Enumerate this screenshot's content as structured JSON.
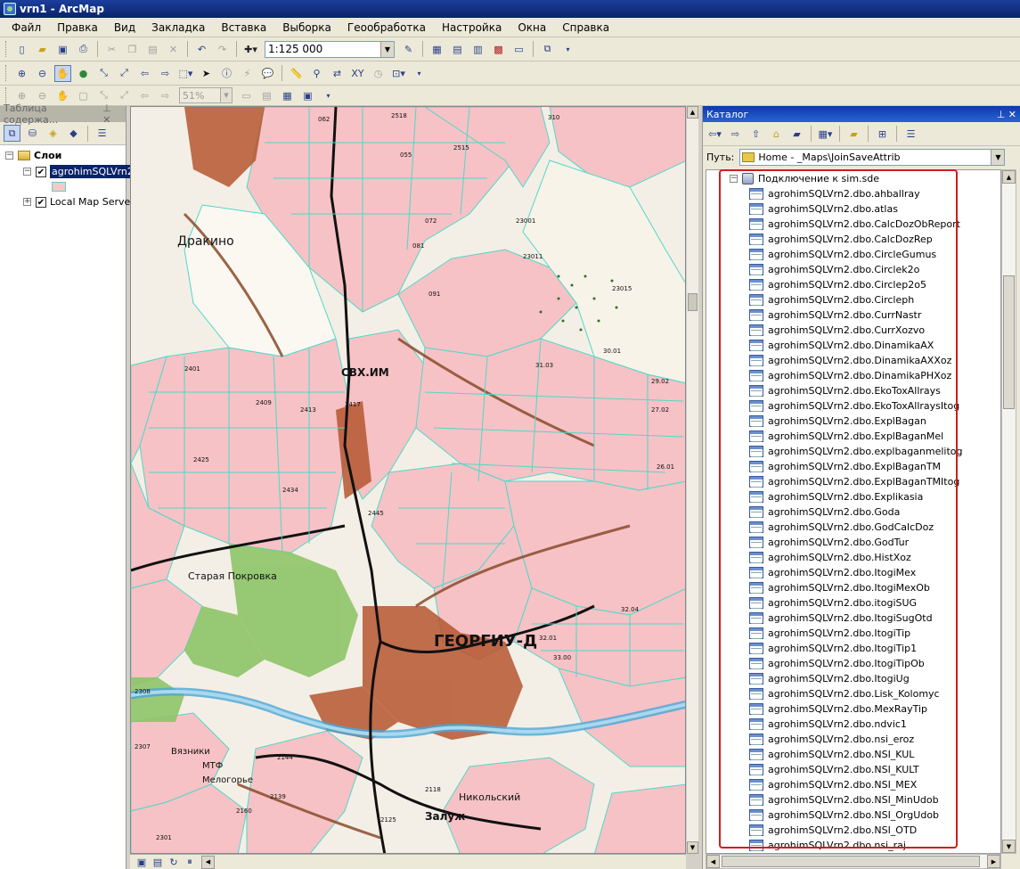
{
  "window": {
    "title": "vrn1 - ArcMap"
  },
  "menu": [
    "Файл",
    "Правка",
    "Вид",
    "Закладка",
    "Вставка",
    "Выборка",
    "Геообработка",
    "Настройка",
    "Окна",
    "Справка"
  ],
  "toolbar": {
    "scale": "1:125 000",
    "zoom_percent": "51%"
  },
  "toc": {
    "title": "Таблица содержа...",
    "root_label": "Слои",
    "layers": [
      {
        "label": "agrohimSQLVrn2",
        "checked": true,
        "selected": true
      },
      {
        "label": "Local Map Serve",
        "checked": true,
        "selected": false
      }
    ]
  },
  "catalog": {
    "title": "Каталог",
    "path_label": "Путь:",
    "path_value": "Home - _Maps\\JoinSaveAttrib",
    "connection": "Подключение к sim.sde",
    "items": [
      "agrohimSQLVrn2.dbo.ahballray",
      "agrohimSQLVrn2.dbo.atlas",
      "agrohimSQLVrn2.dbo.CalcDozObReport",
      "agrohimSQLVrn2.dbo.CalcDozRep",
      "agrohimSQLVrn2.dbo.CircleGumus",
      "agrohimSQLVrn2.dbo.Circlek2o",
      "agrohimSQLVrn2.dbo.Circlep2o5",
      "agrohimSQLVrn2.dbo.Circleph",
      "agrohimSQLVrn2.dbo.CurrNastr",
      "agrohimSQLVrn2.dbo.CurrXozvo",
      "agrohimSQLVrn2.dbo.DinamikaAX",
      "agrohimSQLVrn2.dbo.DinamikaAXXoz",
      "agrohimSQLVrn2.dbo.DinamikaPHXoz",
      "agrohimSQLVrn2.dbo.EkoToxAllrays",
      "agrohimSQLVrn2.dbo.EkoToxAllraysItog",
      "agrohimSQLVrn2.dbo.ExplBagan",
      "agrohimSQLVrn2.dbo.ExplBaganMel",
      "agrohimSQLVrn2.dbo.explbaganmelitog",
      "agrohimSQLVrn2.dbo.ExplBaganTM",
      "agrohimSQLVrn2.dbo.ExplBaganTMItog",
      "agrohimSQLVrn2.dbo.Explikasia",
      "agrohimSQLVrn2.dbo.Goda",
      "agrohimSQLVrn2.dbo.GodCalcDoz",
      "agrohimSQLVrn2.dbo.GodTur",
      "agrohimSQLVrn2.dbo.HistXoz",
      "agrohimSQLVrn2.dbo.ItogiMex",
      "agrohimSQLVrn2.dbo.ItogiMexOb",
      "agrohimSQLVrn2.dbo.itogiSUG",
      "agrohimSQLVrn2.dbo.ItogiSugOtd",
      "agrohimSQLVrn2.dbo.ItogiTip",
      "agrohimSQLVrn2.dbo.ItogiTip1",
      "agrohimSQLVrn2.dbo.ItogiTipOb",
      "agrohimSQLVrn2.dbo.ItogiUg",
      "agrohimSQLVrn2.dbo.Lisk_Kolomyc",
      "agrohimSQLVrn2.dbo.MexRayTip",
      "agrohimSQLVrn2.dbo.ndvic1",
      "agrohimSQLVrn2.dbo.nsi_eroz",
      "agrohimSQLVrn2.dbo.NSI_KUL",
      "agrohimSQLVrn2.dbo.NSI_KULT",
      "agrohimSQLVrn2.dbo.NSI_MEX",
      "agrohimSQLVrn2.dbo.NSI_MinUdob",
      "agrohimSQLVrn2.dbo.NSI_OrgUdob",
      "agrohimSQLVrn2.dbo.NSI_OTD",
      "agrohimSQLVrn2.dbo.nsi_raj"
    ]
  },
  "map": {
    "labels": [
      {
        "t": "Дракино"
      },
      {
        "t": "СВХ.ИМ"
      },
      {
        "t": "ГЕОРГИУ-Д"
      },
      {
        "t": "Старая Покровка"
      },
      {
        "t": "Вязники"
      },
      {
        "t": "Залуж"
      },
      {
        "t": "Никольский"
      },
      {
        "t": "МТФ"
      },
      {
        "t": "Мелогорье"
      },
      {
        "t": "2401"
      },
      {
        "t": "2409"
      },
      {
        "t": "2413"
      },
      {
        "t": "2417"
      },
      {
        "t": "2425"
      },
      {
        "t": "2434"
      },
      {
        "t": "2445"
      },
      {
        "t": "072"
      },
      {
        "t": "081"
      },
      {
        "t": "091"
      },
      {
        "t": "2515"
      },
      {
        "t": "23001"
      },
      {
        "t": "23011"
      },
      {
        "t": "23015"
      },
      {
        "t": "30.01"
      },
      {
        "t": "29.02"
      },
      {
        "t": "27.02"
      },
      {
        "t": "26.01"
      },
      {
        "t": "31.03"
      },
      {
        "t": "32.01"
      },
      {
        "t": "32.04"
      },
      {
        "t": "33.00"
      },
      {
        "t": "2144"
      },
      {
        "t": "2139"
      },
      {
        "t": "2160"
      },
      {
        "t": "2118"
      },
      {
        "t": "2125"
      },
      {
        "t": "2308"
      },
      {
        "t": "2307"
      },
      {
        "t": "2301"
      },
      {
        "t": "310"
      },
      {
        "t": "2518"
      },
      {
        "t": "062"
      },
      {
        "t": "055"
      }
    ]
  }
}
